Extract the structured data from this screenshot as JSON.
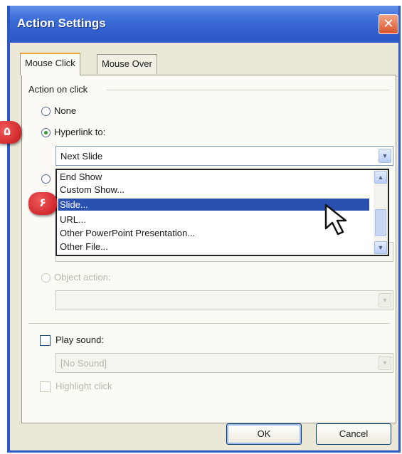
{
  "dialog": {
    "title": "Action Settings",
    "close_glyph": "✕"
  },
  "tabs": [
    {
      "label": "Mouse Click",
      "active": true
    },
    {
      "label": "Mouse Over",
      "active": false
    }
  ],
  "section": {
    "label": "Action on click"
  },
  "options": {
    "none": {
      "label": "None",
      "checked": false
    },
    "hyperlink": {
      "label": "Hyperlink to:",
      "checked": true
    }
  },
  "hyperlink_combo": {
    "value": "Next Slide",
    "arrow_icon": "chevron-down-icon"
  },
  "dropdown_list": {
    "items": [
      {
        "label": "End Show",
        "selected": false
      },
      {
        "label": "Custom Show...",
        "selected": false
      },
      {
        "label": "Slide...",
        "selected": true
      },
      {
        "label": "URL...",
        "selected": false
      },
      {
        "label": "Other PowerPoint Presentation...",
        "selected": false
      },
      {
        "label": "Other File...",
        "selected": false
      }
    ]
  },
  "object_action": {
    "label": "Object action:",
    "value": ""
  },
  "play_sound": {
    "label": "Play sound:",
    "checked": false,
    "value": "[No Sound]"
  },
  "highlight": {
    "label": "Highlight click",
    "checked": false
  },
  "buttons": {
    "ok": "OK",
    "cancel": "Cancel"
  },
  "badges": {
    "step5": "۵",
    "step6": "۶"
  },
  "colors": {
    "titlebar": "#2a57c5",
    "selection": "#2a51b0",
    "badge": "#c3161c",
    "dialog_bg": "#ebe8d8"
  }
}
